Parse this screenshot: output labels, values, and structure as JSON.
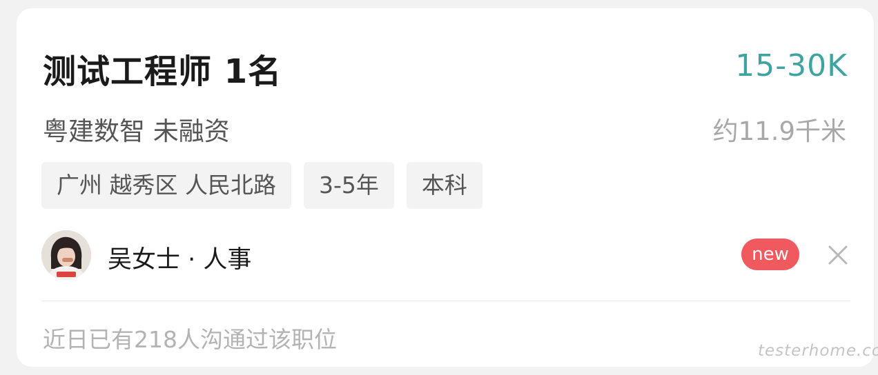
{
  "job": {
    "title": "测试工程师 1名",
    "salary": "15-30K",
    "company": "粤建数智 未融资",
    "distance": "约11.9千米",
    "tags": [
      "广州 越秀区 人民北路",
      "3-5年",
      "本科"
    ]
  },
  "recruiter": {
    "name": "吴女士 · 人事",
    "badge": "new",
    "avatar_icon": "avatar-photo"
  },
  "footer": {
    "note": "近日已有218人沟通过该职位"
  },
  "watermark": "testerhome.com",
  "colors": {
    "salary": "#3fa3a1",
    "badge": "#f05a5f",
    "background": "#f2f2f2",
    "card": "#ffffff"
  }
}
